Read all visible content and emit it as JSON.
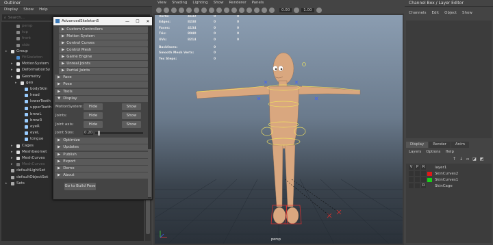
{
  "outliner": {
    "title": "Outliner",
    "menu": [
      "Display",
      "Show",
      "Help"
    ],
    "search_placeholder": "Search...",
    "items": [
      {
        "label": "persp",
        "faded": true
      },
      {
        "label": "top",
        "faded": true
      },
      {
        "label": "front",
        "faded": true
      },
      {
        "label": "side",
        "faded": true
      },
      {
        "label": "Group",
        "faded": false
      },
      {
        "label": "FitSkeleton",
        "faded": true
      },
      {
        "label": "MotionSystem",
        "faded": false
      },
      {
        "label": "DeformationSy",
        "faded": false
      },
      {
        "label": "Geometry",
        "faded": false
      },
      {
        "label": "geo",
        "faded": false
      },
      {
        "label": "bodySkin",
        "faded": false
      },
      {
        "label": "head",
        "faded": false
      },
      {
        "label": "lowerTeeth",
        "faded": false
      },
      {
        "label": "upperTeeth",
        "faded": false
      },
      {
        "label": "browL",
        "faded": false
      },
      {
        "label": "browR",
        "faded": false
      },
      {
        "label": "eyeR",
        "faded": false
      },
      {
        "label": "eyeL",
        "faded": false
      },
      {
        "label": "tongue",
        "faded": false
      },
      {
        "label": "Cages",
        "faded": false
      },
      {
        "label": "MeshGeomet",
        "faded": false
      },
      {
        "label": "MeshCurves",
        "faded": false
      },
      {
        "label": "MeshCurves",
        "faded": true
      },
      {
        "label": "defaultLightSet",
        "faded": false
      },
      {
        "label": "defaultObjectSet",
        "faded": false
      },
      {
        "label": "Sets",
        "faded": false
      }
    ]
  },
  "advskel": {
    "title": "AdvancedSkeleton5",
    "window_controls": [
      "—",
      "☐",
      "✕"
    ],
    "sub_buttons": [
      "Custom Controllers",
      "Motion System",
      "Control Curves",
      "Control Mesh",
      "Game Engine",
      "Unreal Joints",
      "Partial Joints"
    ],
    "frames_top": [
      "Face",
      "Pose",
      "Tools",
      "Display"
    ],
    "display_rows": [
      {
        "label": "MotionSystem:",
        "hide": "Hide",
        "show": "Show"
      },
      {
        "label": "Joints:",
        "hide": "Hide",
        "show": "Show"
      },
      {
        "label": "Joint axis:",
        "hide": "Hide",
        "show": "Show"
      }
    ],
    "joint_size_label": "Joint Size:",
    "joint_size_value": "0.20",
    "joint_size_fraction": 0.05,
    "frames_bottom": [
      "Optimize",
      "Updates",
      "Publish",
      "Export",
      "Demo",
      "About"
    ],
    "goto_button": "Go to Build Pose"
  },
  "viewport": {
    "menu": [
      "View",
      "Shading",
      "Lighting",
      "Show",
      "Renderer",
      "Panels"
    ],
    "hud_rows": [
      {
        "label": "Verts:",
        "a": "4132",
        "b": "0",
        "c": "0"
      },
      {
        "label": "Edges:",
        "a": "8238",
        "b": "0",
        "c": "0"
      },
      {
        "label": "Faces:",
        "a": "4134",
        "b": "0",
        "c": "0"
      },
      {
        "label": "Tris:",
        "a": "8040",
        "b": "0",
        "c": "0"
      },
      {
        "label": "UVs:",
        "a": "8214",
        "b": "0",
        "c": "0"
      }
    ],
    "hud_rows2": [
      {
        "label": "Backfaces:",
        "a": "0"
      },
      {
        "label": "Smooth Mesh Verts:",
        "a": "0"
      },
      {
        "label": "Tex Steps:",
        "a": "0"
      }
    ],
    "toolbar_values": [
      "0.00",
      "1.00"
    ],
    "camera_label": "persp"
  },
  "channel_box": {
    "title": "Channel Box / Layer Editor",
    "menu": [
      "Channels",
      "Edit",
      "Object",
      "Show"
    ],
    "tabs": [
      "Display",
      "Render",
      "Anim"
    ],
    "layer_menu": [
      "Layers",
      "Options",
      "Help"
    ],
    "layers": [
      {
        "v": "V",
        "p": "P",
        "r": "R",
        "name": "layer1",
        "color": ""
      },
      {
        "v": "",
        "p": "",
        "r": "",
        "name": "SkinCurves2",
        "color": "#e01818"
      },
      {
        "v": "",
        "p": "",
        "r": "",
        "name": "SkinCurves1",
        "color": "#18d018"
      },
      {
        "v": "",
        "p": "",
        "r": "R",
        "name": "SkinCage",
        "color": ""
      }
    ]
  },
  "colors": {
    "accent": "#5285a6",
    "selection": "#5285a6",
    "viewport_top": "#8b9db1",
    "viewport_bottom": "#2a3139"
  }
}
